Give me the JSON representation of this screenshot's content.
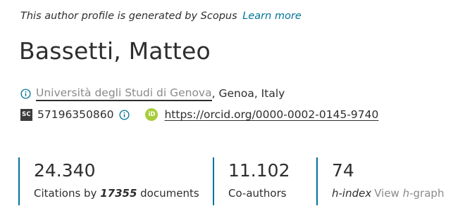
{
  "notice": {
    "text": "This author profile is generated by Scopus",
    "link": "Learn more"
  },
  "author": {
    "name": "Bassetti, Matteo",
    "affiliation": "Università degli Studi di Genova",
    "location": ", Genoa, Italy",
    "sc_badge": "SC",
    "scopus_id": "57196350860",
    "orcid_badge": "iD",
    "orcid_url": "https://orcid.org/0000-0002-0145-9740"
  },
  "metrics": {
    "citations": {
      "value": "24.340",
      "label_prefix": "Citations by ",
      "documents": "17355",
      "label_suffix": " documents"
    },
    "coauthors": {
      "value": "11.102",
      "label": "Co-authors"
    },
    "hindex": {
      "value": "74",
      "label": "h-index",
      "link_prefix": "View ",
      "link_italic": "h",
      "link_suffix": "-graph"
    }
  },
  "colors": {
    "accent": "#007398",
    "orcid": "#a6ce39",
    "text": "#2e2e2e",
    "muted": "#8a8a8a"
  },
  "icons": {
    "info": "info-circle-icon",
    "scopus": "scopus-sc-icon",
    "orcid": "orcid-icon"
  }
}
